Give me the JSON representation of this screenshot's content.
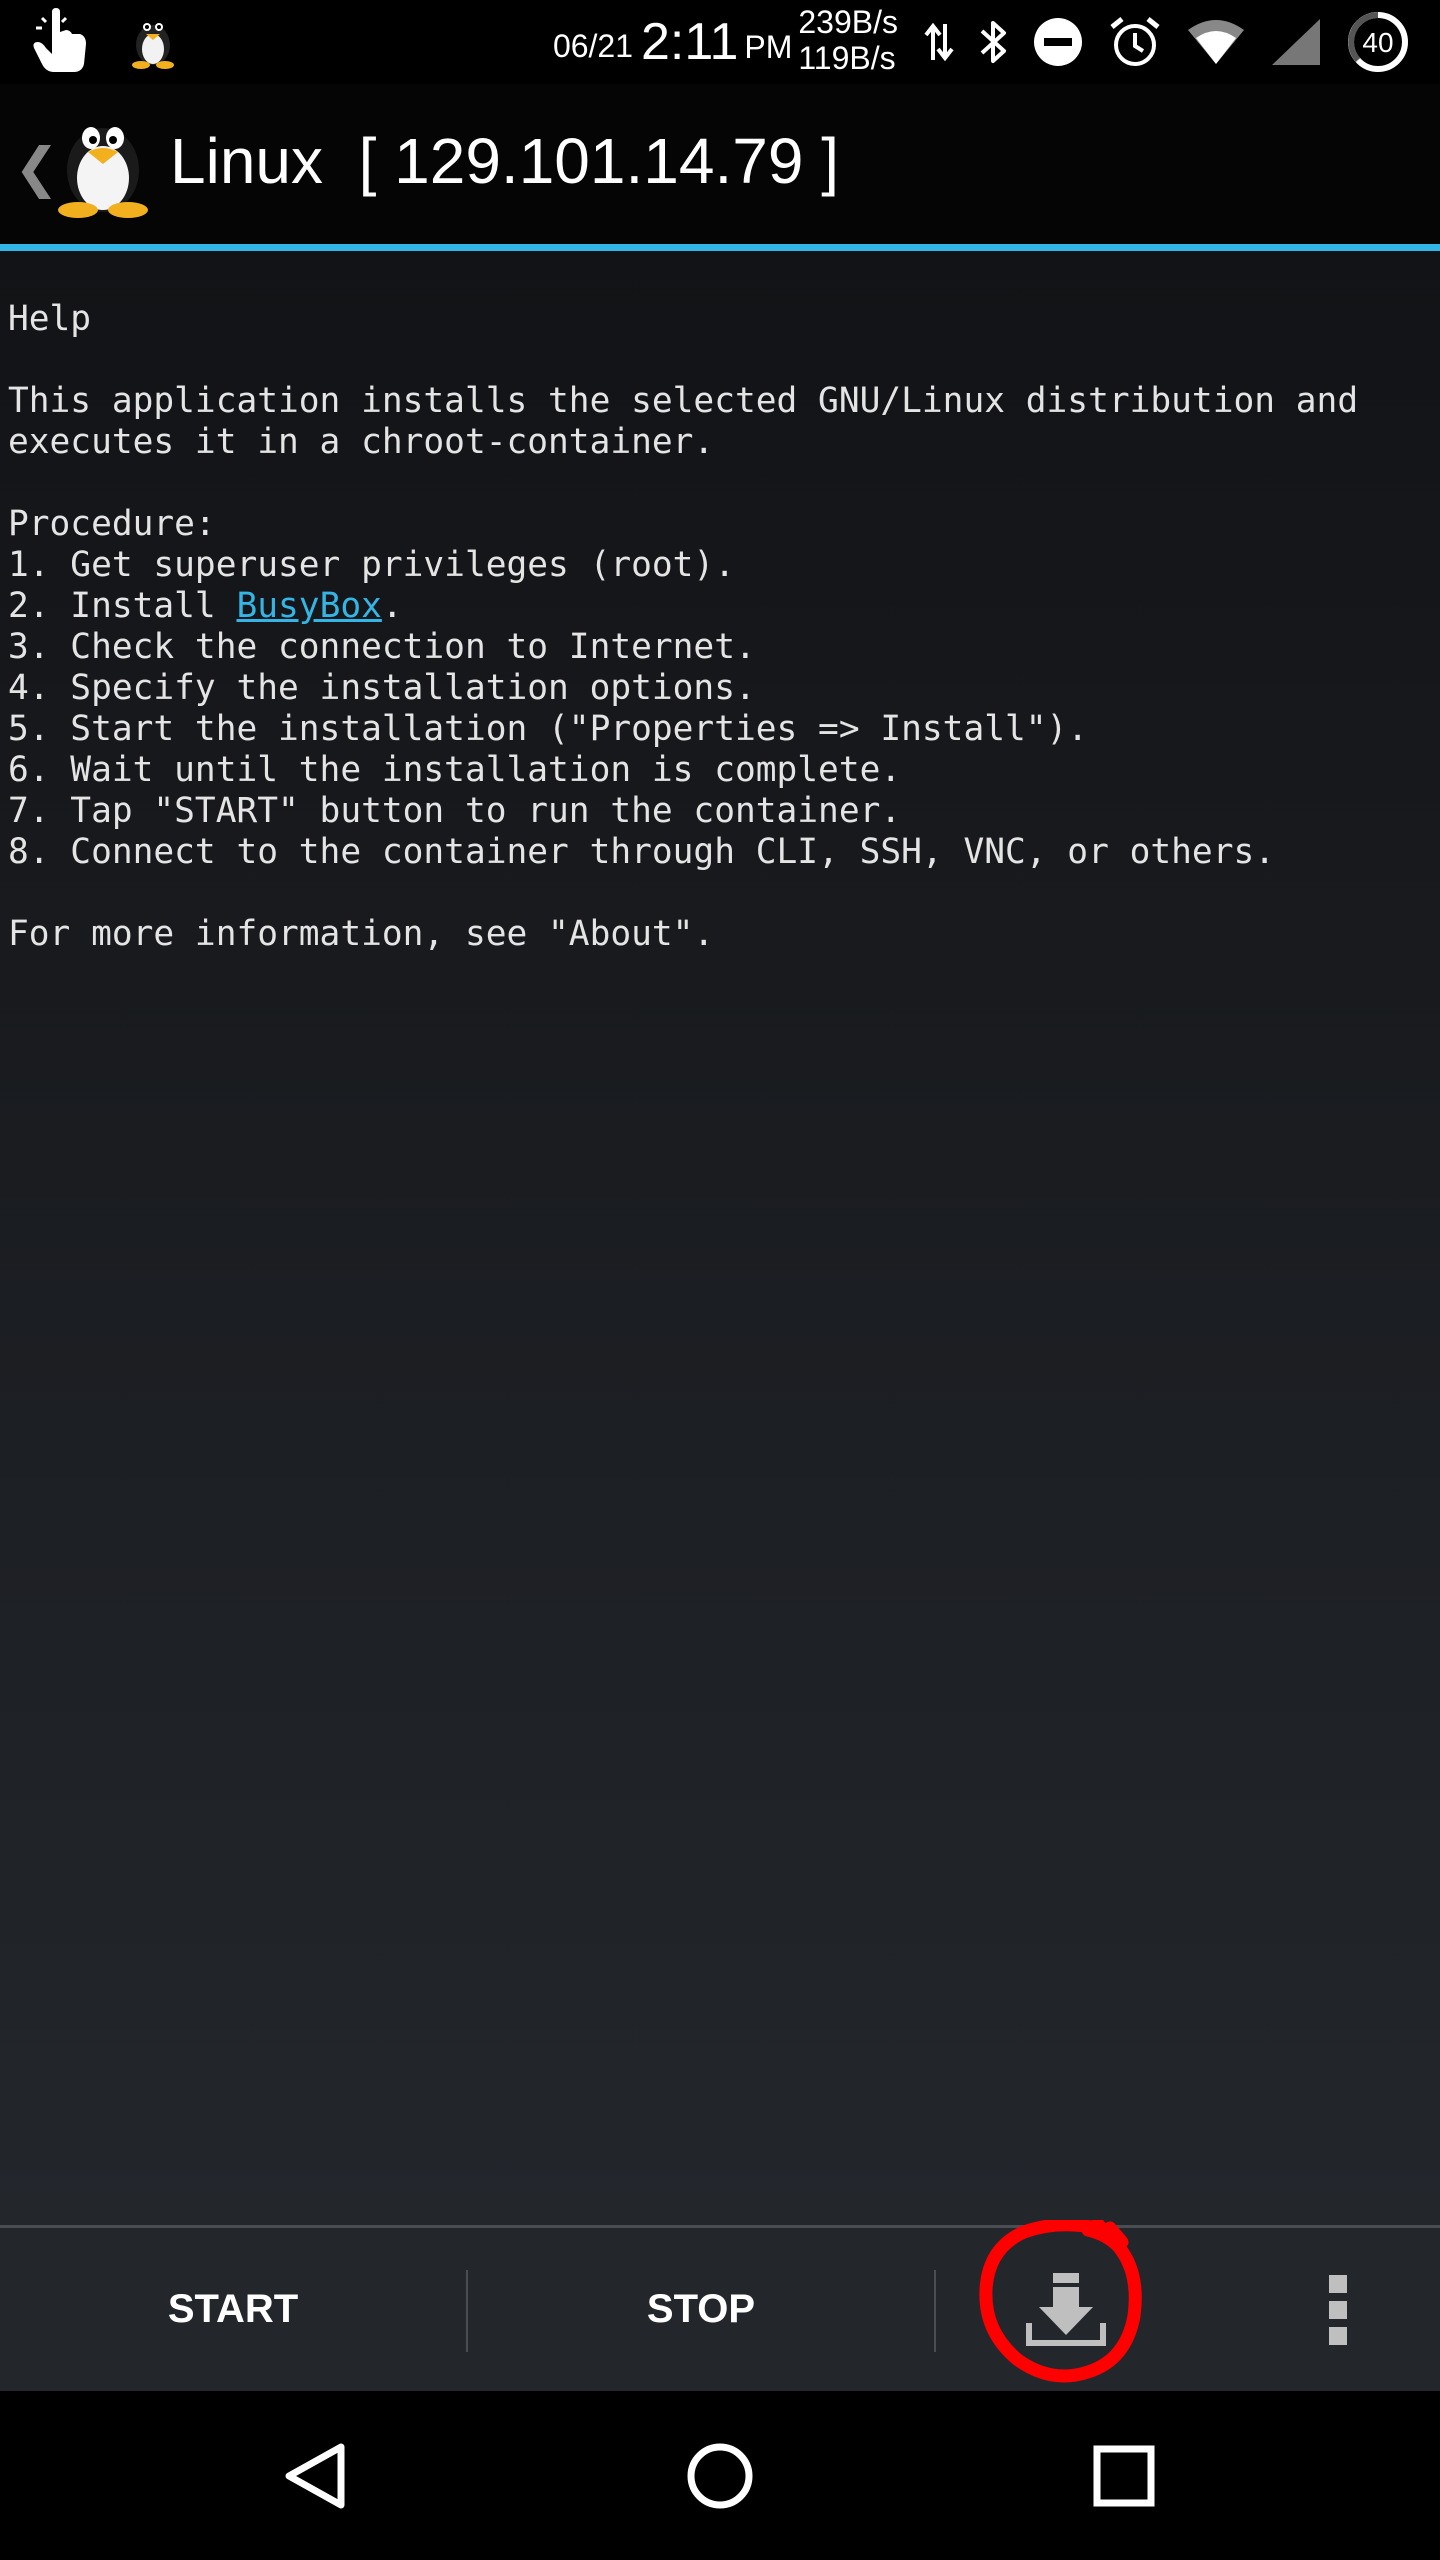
{
  "status_bar": {
    "date": "06/21",
    "time": "2:11",
    "ampm": "PM",
    "net_up": "239B/s",
    "net_down": "119B/s",
    "battery": "40",
    "icons": [
      "touch-icon",
      "tux-notification-icon",
      "data-transfer-icon",
      "bluetooth-icon",
      "do-not-disturb-icon",
      "alarm-icon",
      "wifi-icon",
      "cell-signal-icon",
      "battery-icon"
    ]
  },
  "action_bar": {
    "back_glyph": "❮",
    "title": "Linux  [ 129.101.14.79 ]"
  },
  "help": {
    "heading": "Help",
    "intro_1": "This application installs the selected GNU/Linux distribution and",
    "intro_2": "executes it in a chroot-container.",
    "procedure_label": "Procedure:",
    "step_1": "1. Get superuser privileges (root).",
    "step_2_prefix": "2. Install ",
    "step_2_link": "BusyBox",
    "step_2_suffix": ".",
    "step_3": "3. Check the connection to Internet.",
    "step_4": "4. Specify the installation options.",
    "step_5": "5. Start the installation (\"Properties => Install\").",
    "step_6": "6. Wait until the installation is complete.",
    "step_7": "7. Tap \"START\" button to run the container.",
    "step_8": "8. Connect to the container through CLI, SSH, VNC, or others.",
    "more_info": "For more information, see \"About\"."
  },
  "toolbar": {
    "start_label": "START",
    "stop_label": "STOP",
    "install_icon": "download-icon",
    "overflow_icon": "overflow-menu-icon",
    "annotation_color": "#ff0000"
  },
  "colors": {
    "accent": "#33b5e5",
    "background_top": "#121316",
    "background_bottom": "#23272c"
  },
  "nav_bar": {
    "icons": [
      "back-icon",
      "home-icon",
      "recents-icon"
    ]
  }
}
